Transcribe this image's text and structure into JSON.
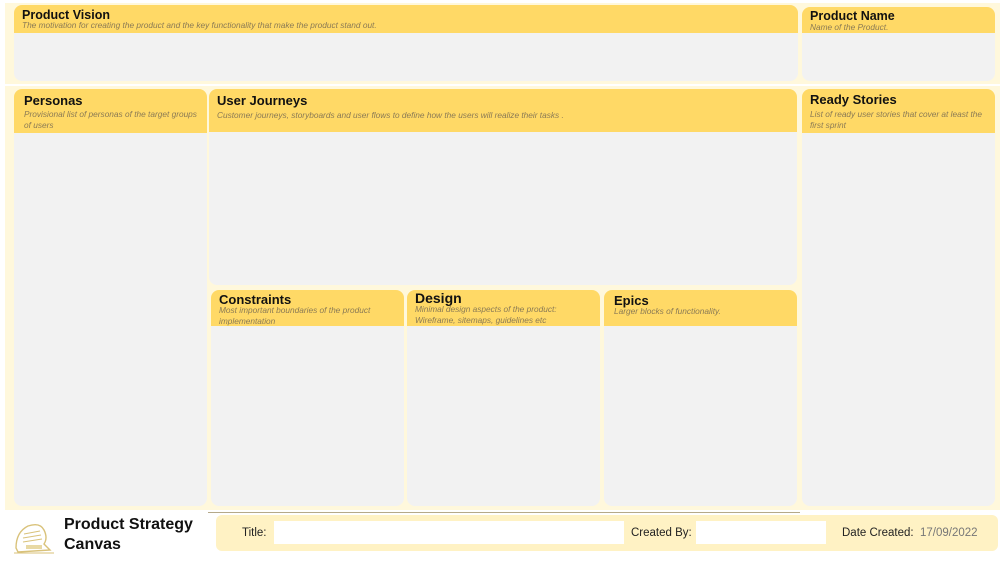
{
  "canvas": {
    "product_vision": {
      "title": "Product Vision",
      "description": "The motivation for creating the product and the key functionality that make the product stand out."
    },
    "product_name": {
      "title": "Product Name",
      "description": "Name of the Product."
    },
    "personas": {
      "title": "Personas",
      "description": "Provisional list of personas of the target groups of users"
    },
    "user_journeys": {
      "title": "User Journeys",
      "description": "Customer journeys, storyboards and user flows to define how the users will realize their tasks ."
    },
    "ready_stories": {
      "title": "Ready Stories",
      "description": "List of ready user stories that cover at least the first sprint"
    },
    "constraints": {
      "title": "Constraints",
      "description": "Most important boundaries of the product implementation"
    },
    "design": {
      "title": "Design",
      "description": "Minimal design aspects of the product: Wireframe, sitemaps, guidelines etc"
    },
    "epics": {
      "title": "Epics",
      "description": "Larger blocks of functionality."
    }
  },
  "footer": {
    "canvas_title": "Product Strategy Canvas",
    "logo_icon": "bookstack-logo-icon",
    "title_label": "Title:",
    "title_value": "",
    "created_by_label": "Created By:",
    "created_by_value": "",
    "date_created_label": "Date Created:",
    "date_created_value": "17/09/2022"
  },
  "colors": {
    "header_yellow": "#ffd966",
    "body_gray": "#f2f2f2",
    "band_cream": "#fff8dc",
    "description_text": "#8a7a55"
  }
}
